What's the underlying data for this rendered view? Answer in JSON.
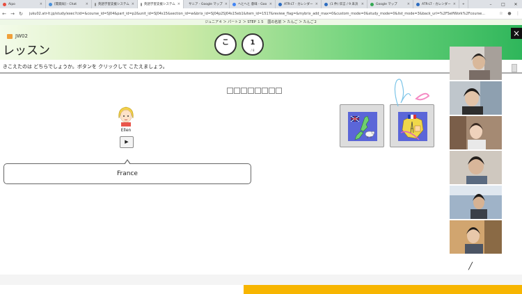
{
  "browser": {
    "tabs": [
      {
        "label": "Aipo",
        "color": "#e84c3d",
        "active": false
      },
      {
        "label": "[開発局] - Chat",
        "color": "#4a90d9",
        "active": false
      },
      {
        "label": "英語学習支援システム",
        "color": "#888888",
        "active": false
      },
      {
        "label": "英語学習支援システム",
        "color": "#888888",
        "active": true
      },
      {
        "label": "サニア - Google マップ",
        "color": "#34a853",
        "active": false
      },
      {
        "label": "へとへと 意味 - Goo",
        "color": "#4285f4",
        "active": false
      },
      {
        "label": "ATR-LT - カレンダー",
        "color": "#2d6cc0",
        "active": false
      },
      {
        "label": "(1 件) 伝言 / 9 未決",
        "color": "#2d6cc0",
        "active": false
      },
      {
        "label": "Google マップ",
        "color": "#34a853",
        "active": false
      },
      {
        "label": "ATR-LT - カレンダー",
        "color": "#2d6cc0",
        "active": false
      }
    ],
    "url": "juku02.atr-lt.jp/study/exec?cid=&course_id=SJ04&part_id=p2&unit_id=SJ04s15&section_id=w&brix_id=SJ04p2SJ04s15eb1&item_id=1517&review_flag=&mybrix_add_max=0&custom_mode=0&study_mode=0&list_mode=3&back_url=%2FSelfWork%2Fcourse..."
  },
  "breadcrumb": "ジュニア４ ＞ パート２ ＞ STEP １５　国の名前 ＞ たんご ＞ たんご２",
  "header": {
    "lesson_code": "JW02",
    "title": "レッスン",
    "progress_left": {
      "big": "こ",
      "small": ""
    },
    "progress_right": {
      "big": "1",
      "small": "/ 8"
    },
    "close": "×"
  },
  "instruction": "きこえたのは どちらでしょうか。ボタンを クリックして こたえましょう。",
  "answer_slots": 8,
  "character": {
    "name": "Ellen",
    "play": "▶"
  },
  "speech": "France",
  "colors": {
    "header_start": "#f3fbe9",
    "header_end": "#2fb65b",
    "accent_bar": "#f7b500"
  },
  "icons": {
    "close": "close-icon",
    "play": "play-icon",
    "back": "back-arrow-icon",
    "forward": "forward-arrow-icon",
    "reload": "reload-icon"
  }
}
